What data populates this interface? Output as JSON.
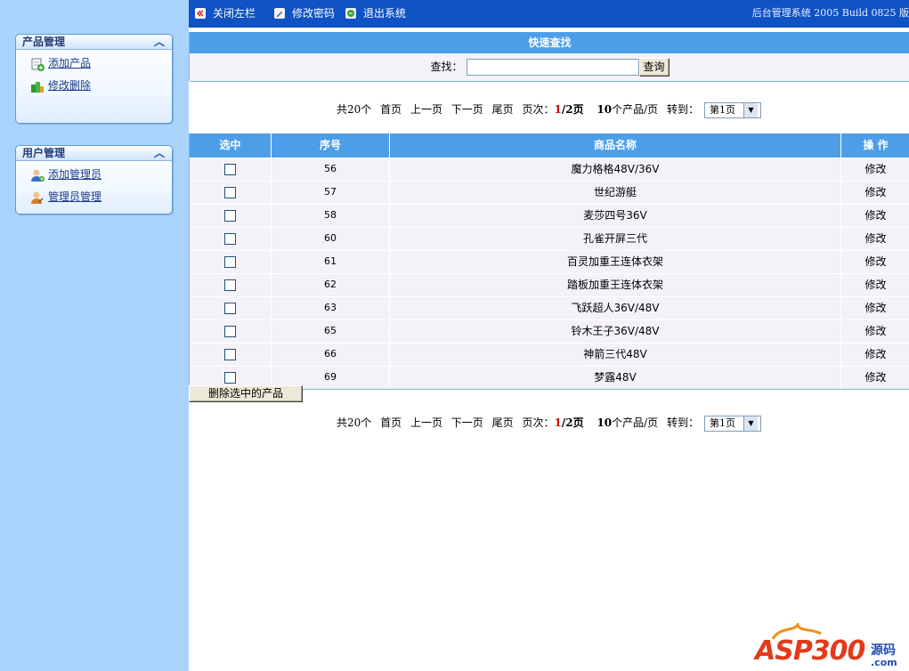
{
  "topbar": {
    "close_left": "关闭左栏",
    "change_password": "修改密码",
    "logout": "退出系统",
    "version": "后台管理系统 2005 Build 0825 版"
  },
  "sidebar": {
    "panels": [
      {
        "title": "产品管理",
        "items": [
          {
            "label": "添加产品",
            "icon": "add-product-icon"
          },
          {
            "label": "修改删除",
            "icon": "edit-delete-icon"
          }
        ]
      },
      {
        "title": "用户管理",
        "items": [
          {
            "label": "添加管理员",
            "icon": "add-admin-icon"
          },
          {
            "label": "管理员管理",
            "icon": "admin-manage-icon"
          }
        ]
      }
    ]
  },
  "search": {
    "title": "快速查找",
    "label": "查找：",
    "value": "",
    "button": "查询"
  },
  "pager": {
    "total": "共20个",
    "first": "首页",
    "prev": "上一页",
    "next": "下一页",
    "last": "尾页",
    "page_label": "页次：",
    "current": "1",
    "total_pages": "/2页",
    "per_page_num": "10",
    "per_page_text": "个产品/页",
    "goto": "转到：",
    "goto_value": "第1页"
  },
  "table": {
    "headers": [
      "选中",
      "序号",
      "商品名称",
      "操 作"
    ],
    "rows": [
      {
        "id": "56",
        "name": "魔力格格48V/36V",
        "action": "修改"
      },
      {
        "id": "57",
        "name": "世纪游艇",
        "action": "修改"
      },
      {
        "id": "58",
        "name": "麦莎四号36V",
        "action": "修改"
      },
      {
        "id": "60",
        "name": "孔雀开屏三代",
        "action": "修改"
      },
      {
        "id": "61",
        "name": "百灵加重王连体衣架",
        "action": "修改"
      },
      {
        "id": "62",
        "name": "踏板加重王连体衣架",
        "action": "修改"
      },
      {
        "id": "63",
        "name": "飞跃超人36V/48V",
        "action": "修改"
      },
      {
        "id": "65",
        "name": "铃木王子36V/48V",
        "action": "修改"
      },
      {
        "id": "66",
        "name": "神箭三代48V",
        "action": "修改"
      },
      {
        "id": "69",
        "name": "梦露48V",
        "action": "修改"
      }
    ],
    "delete_button": "删除选中的产品"
  },
  "watermark": {
    "brand": "ASP300",
    "suffix": "源码",
    "domain": ".com"
  },
  "colors": {
    "sidebar_bg": "#a9d3fb",
    "topbar_bg": "#0f52c4",
    "header_bg": "#4c9ee9",
    "row_bg": "#f5f1f8",
    "page_current": "#d00000"
  }
}
